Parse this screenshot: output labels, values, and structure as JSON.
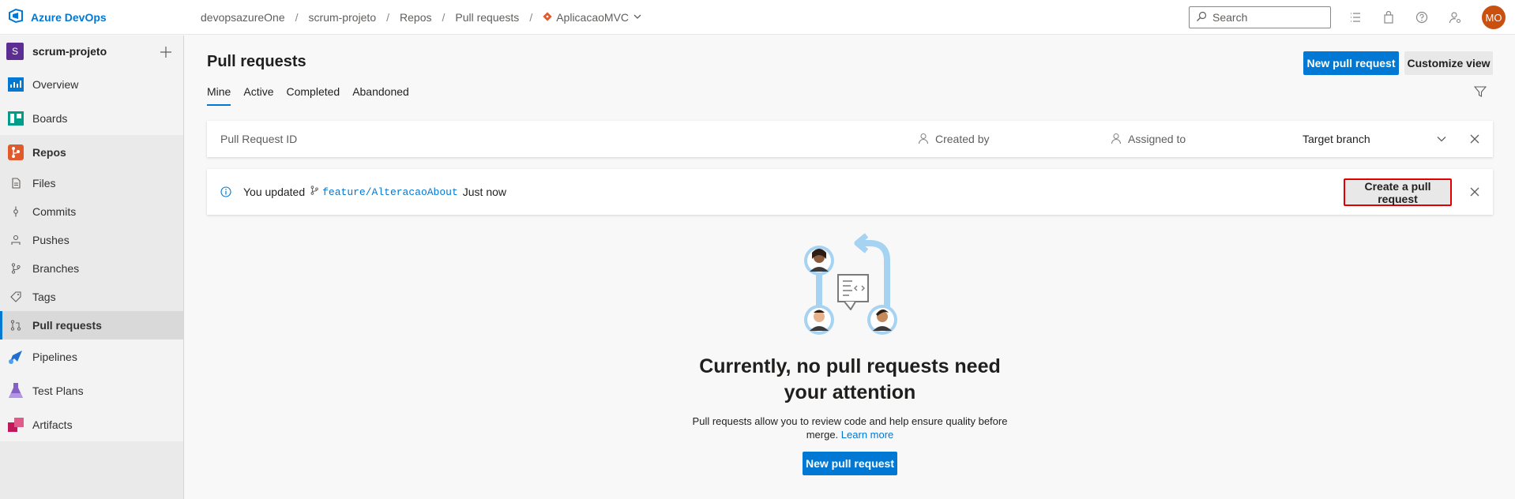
{
  "header": {
    "brand": "Azure DevOps",
    "breadcrumb": [
      "devopsazureOne",
      "scrum-projeto",
      "Repos",
      "Pull requests"
    ],
    "repo": "AplicacaoMVC",
    "search_placeholder": "Search",
    "avatar_initials": "MO"
  },
  "sidebar": {
    "project_initial": "S",
    "project_name": "scrum-projeto",
    "items": [
      {
        "label": "Overview"
      },
      {
        "label": "Boards"
      },
      {
        "label": "Repos"
      },
      {
        "label": "Pipelines"
      },
      {
        "label": "Test Plans"
      },
      {
        "label": "Artifacts"
      }
    ],
    "repos_sub": [
      {
        "label": "Files"
      },
      {
        "label": "Commits"
      },
      {
        "label": "Pushes"
      },
      {
        "label": "Branches"
      },
      {
        "label": "Tags"
      },
      {
        "label": "Pull requests"
      }
    ]
  },
  "main": {
    "title": "Pull requests",
    "new_pr_label": "New pull request",
    "customize_label": "Customize view",
    "tabs": [
      {
        "label": "Mine"
      },
      {
        "label": "Active"
      },
      {
        "label": "Completed"
      },
      {
        "label": "Abandoned"
      }
    ],
    "filters": {
      "id_placeholder": "Pull Request ID",
      "created_by": "Created by",
      "assigned_to": "Assigned to",
      "target_branch": "Target branch"
    },
    "banner": {
      "prefix": "You updated",
      "branch": "feature/AlteracaoAbout",
      "suffix": "Just now",
      "create_label": "Create a pull request"
    },
    "empty": {
      "title": "Currently, no pull requests need your attention",
      "description": "Pull requests allow you to review code and help ensure quality before merge.",
      "learn_more": "Learn more",
      "button_label": "New pull request"
    }
  },
  "colors": {
    "accent": "#0078d4",
    "highlight_border": "#e00000",
    "avatar": "#ca5010",
    "project_badge": "#5c2e91"
  }
}
